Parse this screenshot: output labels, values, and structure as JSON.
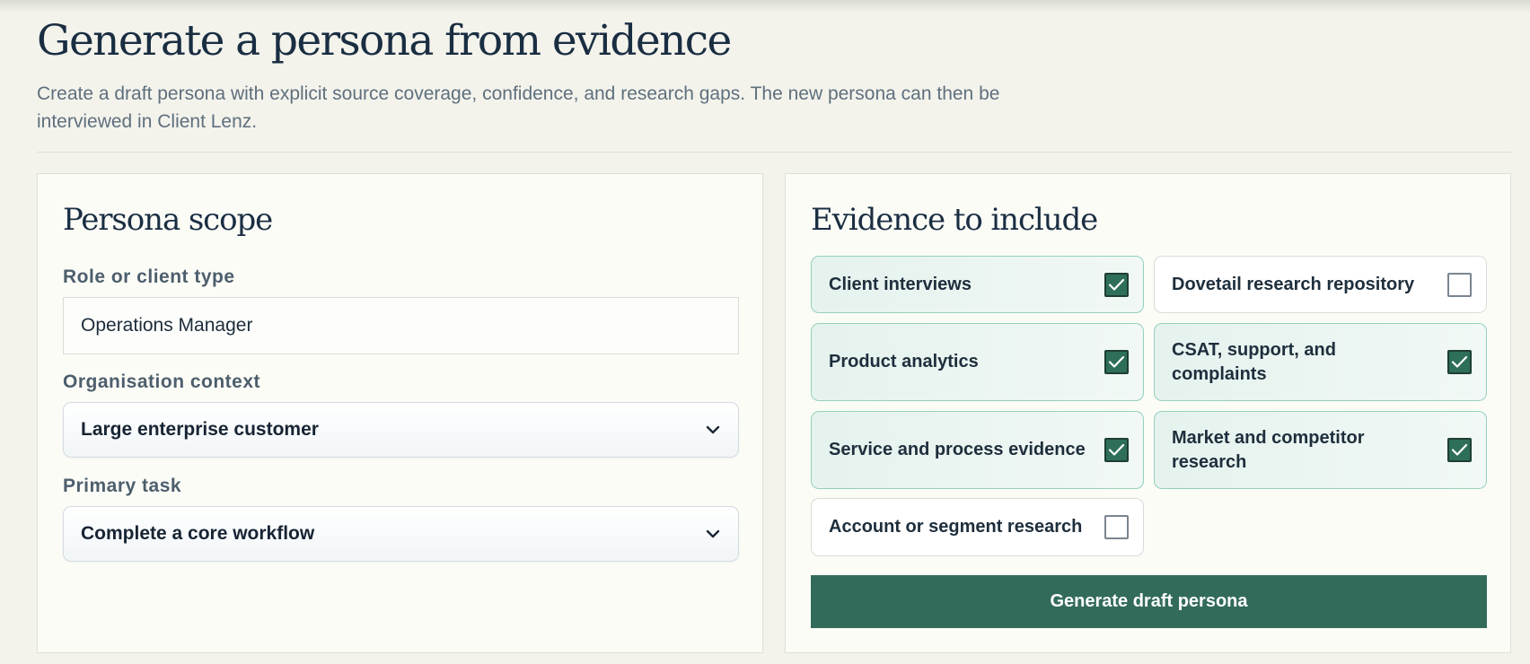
{
  "header": {
    "title": "Generate a persona from evidence",
    "description": "Create a draft persona with explicit source coverage, confidence, and research gaps. The new persona can then be interviewed in Client Lenz."
  },
  "scope": {
    "title": "Persona scope",
    "role": {
      "label": "Role or client type",
      "value": "Operations Manager"
    },
    "organisation": {
      "label": "Organisation context",
      "value": "Large enterprise customer"
    },
    "task": {
      "label": "Primary task",
      "value": "Complete a core workflow"
    }
  },
  "evidence": {
    "title": "Evidence to include",
    "items": [
      {
        "label": "Client interviews",
        "checked": true
      },
      {
        "label": "Dovetail research repository",
        "checked": false
      },
      {
        "label": "Product analytics",
        "checked": true
      },
      {
        "label": "CSAT, support, and complaints",
        "checked": true
      },
      {
        "label": "Service and process evidence",
        "checked": true
      },
      {
        "label": "Market and competitor research",
        "checked": true
      },
      {
        "label": "Account or segment research",
        "checked": false
      }
    ],
    "submit_label": "Generate draft persona"
  },
  "colors": {
    "page_background": "#f3f3ec",
    "accent": "#336b5b",
    "checked_card_border": "#93d0bd",
    "title": "#1a2e42"
  },
  "icons": [
    "chevron-down-icon",
    "checkmark-icon"
  ]
}
